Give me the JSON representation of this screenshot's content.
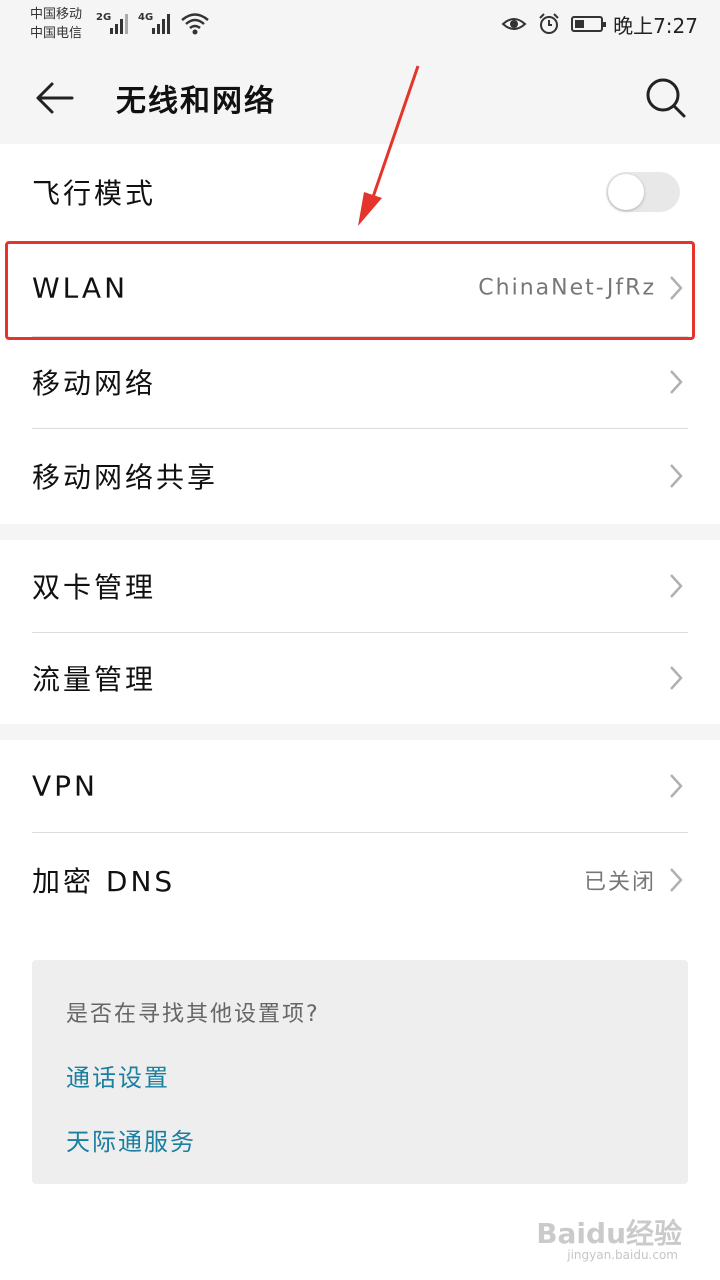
{
  "status_bar": {
    "carrier_1": "中国移动",
    "carrier_2": "中国电信",
    "network_1": "2G",
    "network_2": "4G",
    "time": "晚上7:27",
    "icons": [
      "signal-icon",
      "wifi-icon",
      "eye-icon",
      "alarm-icon",
      "battery-icon"
    ]
  },
  "app_bar": {
    "title": "无线和网络",
    "back_icon": "back-arrow-icon",
    "search_icon": "search-icon"
  },
  "groups": [
    {
      "rows": [
        {
          "label": "飞行模式",
          "control": "toggle",
          "toggle_on": false
        },
        {
          "label": "WLAN",
          "value": "ChinaNet-JfRz",
          "chevron": true,
          "highlighted": true
        },
        {
          "label": "移动网络",
          "chevron": true
        },
        {
          "label": "移动网络共享",
          "chevron": true
        }
      ]
    },
    {
      "rows": [
        {
          "label": "双卡管理",
          "chevron": true
        },
        {
          "label": "流量管理",
          "chevron": true
        }
      ]
    },
    {
      "rows": [
        {
          "label": "VPN",
          "chevron": true
        },
        {
          "label": "加密 DNS",
          "value": "已关闭",
          "chevron": true
        }
      ]
    }
  ],
  "suggestions": {
    "question": "是否在寻找其他设置项?",
    "links": [
      "通话设置",
      "天际通服务"
    ]
  },
  "annotation": {
    "color": "#e5342b"
  },
  "watermark": {
    "text": "Baidu经验",
    "sub": "jingyan.baidu.com"
  },
  "colors": {
    "background": "#f5f5f5",
    "link": "#1a7fa0",
    "toggle_off": "#e8e8e8"
  }
}
